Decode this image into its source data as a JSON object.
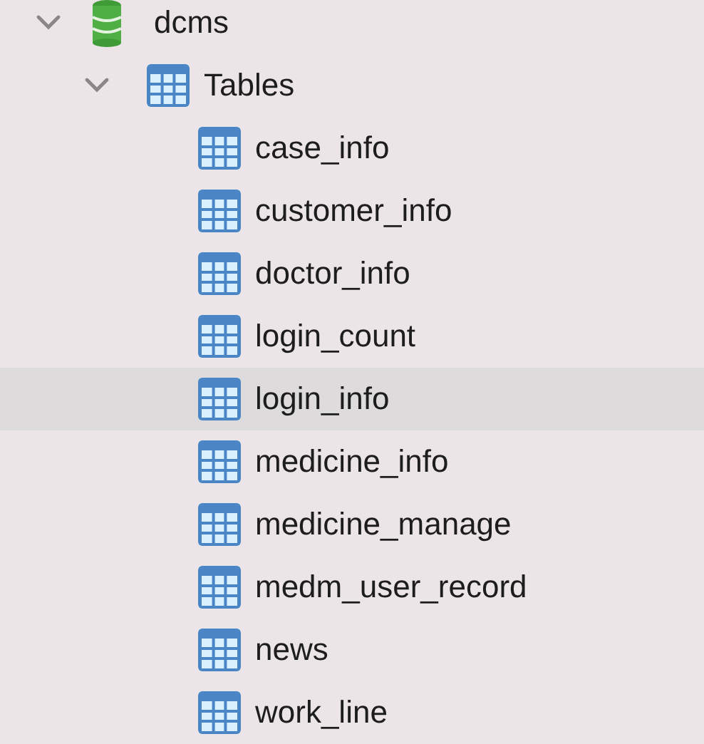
{
  "tree": [
    {
      "label": "dcms",
      "kind": "database",
      "expanded": true,
      "selected": false,
      "children": [
        {
          "label": "Tables",
          "kind": "folder",
          "expanded": true,
          "selected": false,
          "children": [
            {
              "label": "case_info",
              "kind": "table",
              "selected": false
            },
            {
              "label": "customer_info",
              "kind": "table",
              "selected": false
            },
            {
              "label": "doctor_info",
              "kind": "table",
              "selected": false
            },
            {
              "label": "login_count",
              "kind": "table",
              "selected": false
            },
            {
              "label": "login_info",
              "kind": "table",
              "selected": true
            },
            {
              "label": "medicine_info",
              "kind": "table",
              "selected": false
            },
            {
              "label": "medicine_manage",
              "kind": "table",
              "selected": false
            },
            {
              "label": "medm_user_record",
              "kind": "table",
              "selected": false
            },
            {
              "label": "news",
              "kind": "table",
              "selected": false
            },
            {
              "label": "work_line",
              "kind": "table",
              "selected": false
            }
          ]
        }
      ]
    }
  ]
}
